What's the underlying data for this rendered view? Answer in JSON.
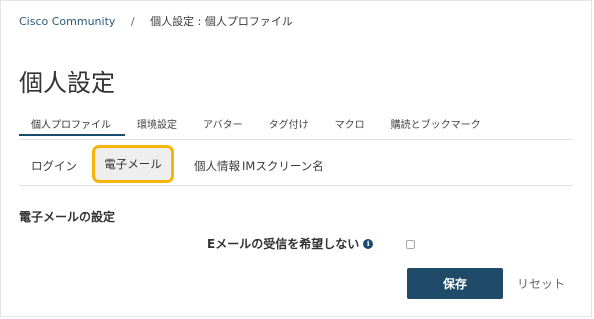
{
  "breadcrumb": {
    "root": "Cisco Community",
    "separator": "/",
    "current": "個人設定 : 個人プロファイル"
  },
  "page": {
    "title": "個人設定"
  },
  "primary_tabs": [
    {
      "label": "個人プロファイル",
      "active": true
    },
    {
      "label": "環境設定",
      "active": false
    },
    {
      "label": "アバター",
      "active": false
    },
    {
      "label": "タグ付け",
      "active": false
    },
    {
      "label": "マクロ",
      "active": false
    },
    {
      "label": "購読とブックマーク",
      "active": false
    }
  ],
  "secondary_tabs": [
    {
      "label": "ログイン",
      "active": false
    },
    {
      "label": "電子メール",
      "active": true
    },
    {
      "label": "個人情報",
      "active": false
    },
    {
      "label": "IMスクリーン名",
      "active": false
    }
  ],
  "email_settings": {
    "section_title": "電子メールの設定",
    "option_label": "Eメールの受信を希望しない",
    "info_icon_glyph": "i",
    "option_checked": false
  },
  "actions": {
    "save_label": "保存",
    "reset_label": "リセット"
  },
  "colors": {
    "accent": "#1f4b68",
    "highlight_border": "#f5b50a",
    "active_tab_bg": "#eeeeee"
  }
}
